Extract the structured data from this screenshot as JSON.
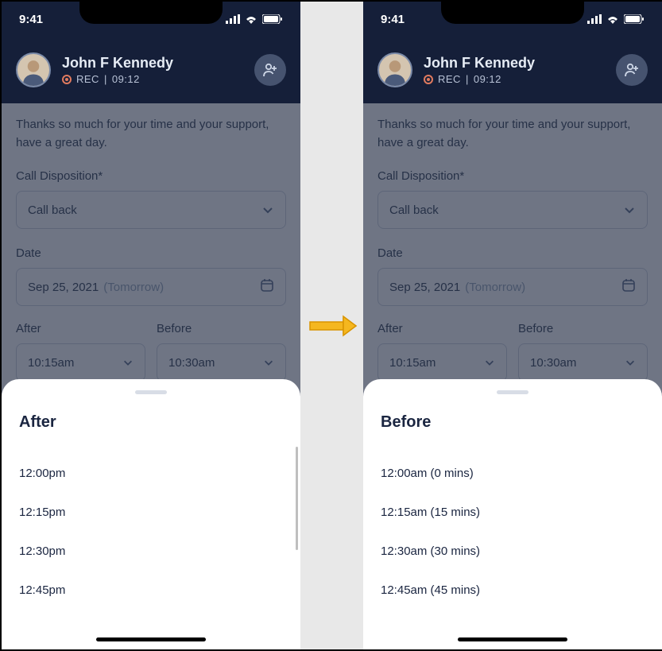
{
  "status": {
    "time": "9:41"
  },
  "header": {
    "name": "John F Kennedy",
    "rec_label": "REC",
    "rec_time": "09:12"
  },
  "transcript": "Thanks so much for your time and your support, have a great day.",
  "form": {
    "disposition_label": "Call Disposition*",
    "disposition_value": "Call back",
    "date_label": "Date",
    "date_value": "Sep 25, 2021",
    "date_sub": "(Tomorrow)",
    "after_label": "After",
    "after_value": "10:15am",
    "before_label": "Before",
    "before_value": "10:30am"
  },
  "sheet_left": {
    "title": "After",
    "items": [
      "12:00pm",
      "12:15pm",
      "12:30pm",
      "12:45pm"
    ]
  },
  "sheet_right": {
    "title": "Before",
    "items": [
      "12:00am (0 mins)",
      "12:15am (15 mins)",
      "12:30am (30 mins)",
      "12:45am (45 mins)"
    ]
  }
}
